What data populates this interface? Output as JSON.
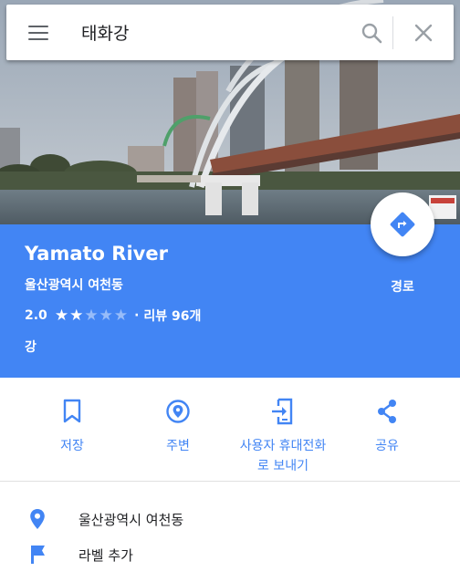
{
  "search": {
    "query": "태화강"
  },
  "place": {
    "name": "Yamato River",
    "address": "울산광역시 여천동",
    "rating": "2.0",
    "rating_value": 2,
    "rating_max": 5,
    "separator": "·",
    "reviews": "리뷰 96개",
    "category": "강",
    "route_label": "경로"
  },
  "actions": {
    "save": "저장",
    "nearby": "주변",
    "send_line1": "사용자 휴대전화",
    "send_line2": "로 보내기",
    "share": "공유"
  },
  "details": {
    "address": "울산광역시 여천동",
    "add_label": "라벨 추가"
  },
  "colors": {
    "accent": "#4285f4",
    "white": "#ffffff"
  },
  "icons": [
    "menu-icon",
    "search-icon",
    "close-icon",
    "directions-icon",
    "bookmark-icon",
    "location-pin-icon",
    "send-to-device-icon",
    "share-icon",
    "flag-icon"
  ]
}
